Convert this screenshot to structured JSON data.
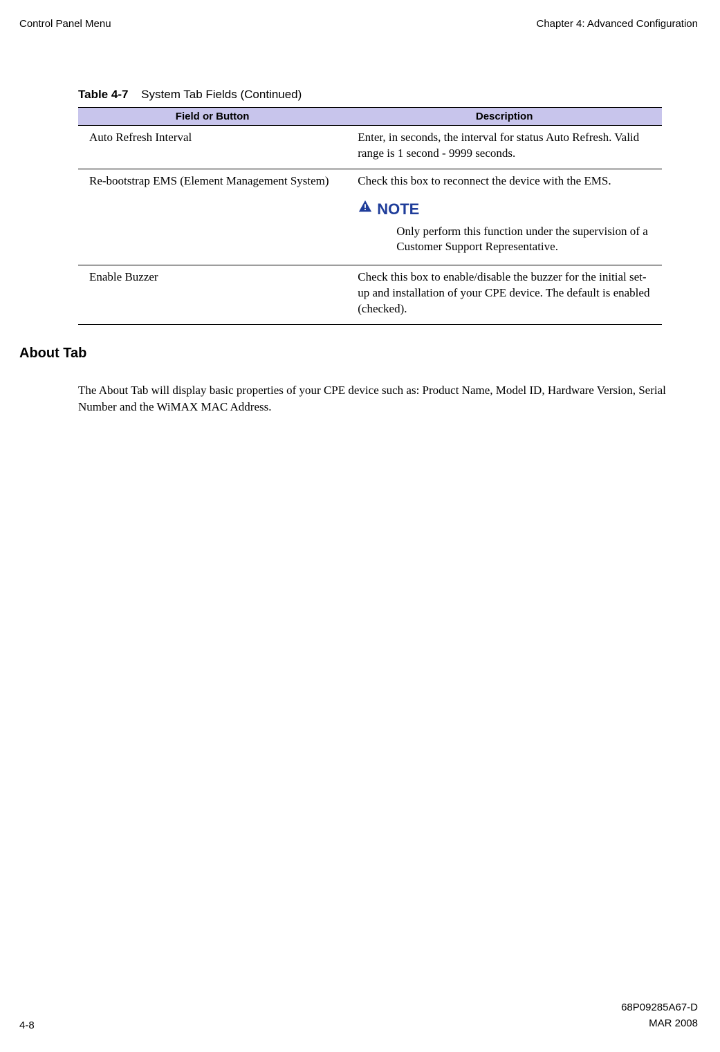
{
  "header": {
    "left": "Control Panel Menu",
    "right": "Chapter 4: Advanced Configuration"
  },
  "tableCaption": {
    "number": "Table 4-7",
    "title": "System Tab Fields (Continued)"
  },
  "tableHeaders": {
    "col1": "Field or Button",
    "col2": "Description"
  },
  "rows": [
    {
      "field": "Auto Refresh Interval",
      "desc": "Enter, in seconds, the interval for status Auto Refresh. Valid range is 1 second - 9999 seconds."
    },
    {
      "field": "Re-bootstrap EMS (Element Management System)",
      "desc": "Check this box to reconnect the device with the EMS.",
      "noteLabel": "NOTE",
      "noteBody": "Only perform this function under the supervision of a Customer Support Representative."
    },
    {
      "field": "Enable Buzzer",
      "desc": "Check this box to enable/disable the buzzer for the initial set-up and installation of your CPE device. The default is enabled (checked)."
    }
  ],
  "aboutTab": {
    "heading": "About Tab",
    "body": "The About Tab will display basic properties of your CPE device such as: Product Name, Model ID, Hardware Version, Serial Number and the WiMAX MAC Address."
  },
  "footer": {
    "pageNumber": "4-8",
    "docNumber": "68P09285A67-D",
    "date": "MAR 2008"
  }
}
